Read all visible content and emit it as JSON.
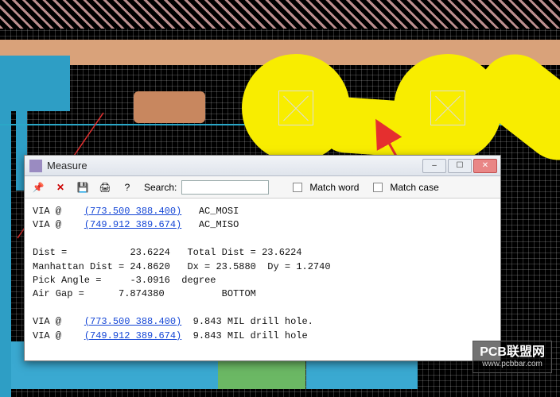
{
  "window": {
    "title": "Measure",
    "buttons": {
      "min": "–",
      "max": "☐",
      "close": "✕"
    }
  },
  "toolbar": {
    "pin_icon": "📌",
    "close_label": "✕",
    "save_icon": "💾",
    "print_icon": "🖨",
    "help_icon": "?",
    "search_label": "Search:",
    "search_value": "",
    "match_word_label": "Match word",
    "match_case_label": "Match case"
  },
  "measure": {
    "via1": {
      "prefix": "VIA @",
      "coord": "(773.500 388.400)",
      "net": "AC_MOSI"
    },
    "via2": {
      "prefix": "VIA @",
      "coord": "(749.912 389.674)",
      "net": "AC_MISO"
    },
    "dist_label": "Dist =",
    "dist_value": "23.6224",
    "total_dist_label": "Total Dist =",
    "total_dist_value": "23.6224",
    "manhattan_label": "Manhattan Dist =",
    "manhattan_value": "24.8620",
    "dx_label": "Dx =",
    "dx_value": "23.5880",
    "dy_label": "Dy =",
    "dy_value": "1.2740",
    "pick_angle_label": "Pick Angle =",
    "pick_angle_value": "-3.0916",
    "pick_angle_unit": "degree",
    "air_gap_label": "Air Gap =",
    "air_gap_value": "7.874380",
    "bottom_label": "BOTTOM",
    "drill1": {
      "prefix": "VIA @",
      "coord": "(773.500 388.400)",
      "desc": "9.843 MIL drill hole."
    },
    "drill2": {
      "prefix": "VIA @",
      "coord": "(749.912 389.674)",
      "desc": "9.843 MIL drill hole"
    }
  },
  "watermark": {
    "title": "PCB联盟网",
    "url": "www.pcbbar.com"
  }
}
